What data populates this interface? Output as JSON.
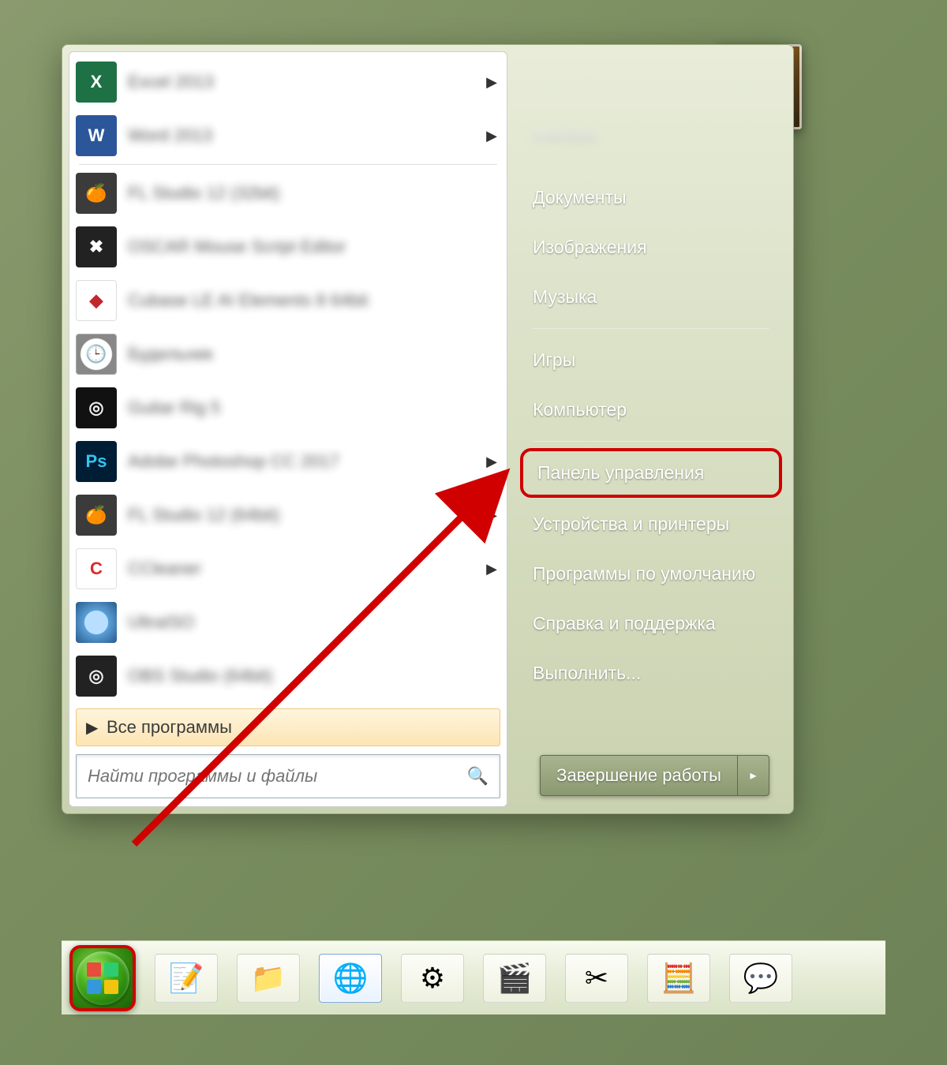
{
  "programs": [
    {
      "label": "Excel 2013",
      "icon": "i-excel",
      "glyph": "X",
      "arrow": true
    },
    {
      "label": "Word 2013",
      "icon": "i-word",
      "glyph": "W",
      "arrow": true
    },
    {
      "label": "FL Studio 12 (32bit)",
      "icon": "i-fl",
      "glyph": "🍊",
      "arrow": false,
      "sep_before": true
    },
    {
      "label": "OSCAR Mouse Script Editor",
      "icon": "i-oscar",
      "glyph": "✖",
      "arrow": false
    },
    {
      "label": "Cubase LE AI Elements 8 64bit",
      "icon": "i-cubase",
      "glyph": "◆",
      "arrow": false
    },
    {
      "label": "Будильник",
      "icon": "i-clock",
      "glyph": "🕒",
      "arrow": false
    },
    {
      "label": "Guitar Rig 5",
      "icon": "i-guitar",
      "glyph": "◎",
      "arrow": false
    },
    {
      "label": "Adobe Photoshop CC 2017",
      "icon": "i-ps",
      "glyph": "Ps",
      "arrow": true
    },
    {
      "label": "FL Studio 12 (64bit)",
      "icon": "i-fl2",
      "glyph": "🍊",
      "arrow": true
    },
    {
      "label": "CCleaner",
      "icon": "i-cc",
      "glyph": "C",
      "arrow": true
    },
    {
      "label": "UltraISO",
      "icon": "i-iso",
      "glyph": "",
      "arrow": false
    },
    {
      "label": "OBS Studio (64bit)",
      "icon": "i-obs",
      "glyph": "◎",
      "arrow": false
    }
  ],
  "all_programs": "Все программы",
  "search_placeholder": "Найти программы и файлы",
  "user_name": "Melissa",
  "right_links": {
    "documents": "Документы",
    "pictures": "Изображения",
    "music": "Музыка",
    "games": "Игры",
    "computer": "Компьютер",
    "control_panel": "Панель управления",
    "devices": "Устройства и принтеры",
    "default_programs": "Программы по умолчанию",
    "help": "Справка и поддержка",
    "run": "Выполнить..."
  },
  "shutdown_label": "Завершение работы",
  "taskbar_items": [
    {
      "name": "notepad",
      "glyph": "📝"
    },
    {
      "name": "explorer",
      "glyph": "📁"
    },
    {
      "name": "chrome",
      "glyph": "🌐",
      "active": true
    },
    {
      "name": "steam",
      "glyph": "⚙"
    },
    {
      "name": "mpc",
      "glyph": "🎬"
    },
    {
      "name": "snip",
      "glyph": "✂"
    },
    {
      "name": "calc",
      "glyph": "🧮"
    },
    {
      "name": "discord",
      "glyph": "💬"
    }
  ]
}
